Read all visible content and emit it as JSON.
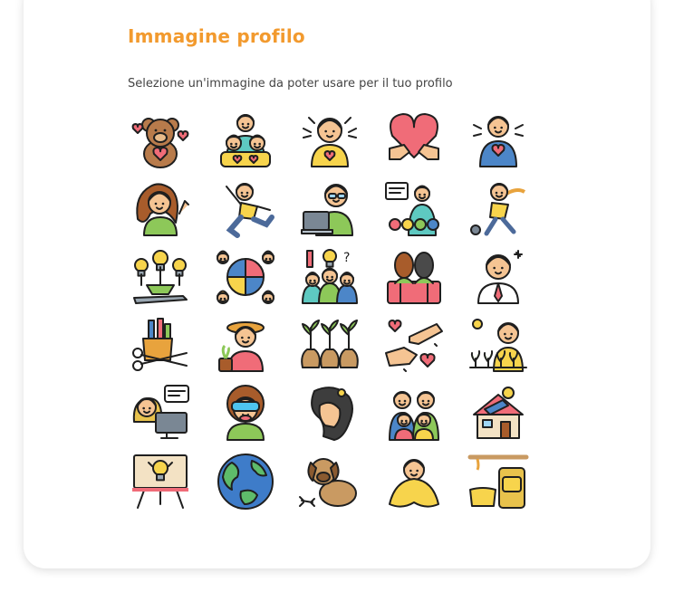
{
  "page": {
    "title": "Immagine profilo",
    "subtitle": "Selezione un'immagine da poter usare per il tuo profilo"
  },
  "colors": {
    "accent": "#F29A2E",
    "outline": "#1f1f1f",
    "skin": "#F5C493",
    "hair": "#6B4A2F",
    "heart": "#F06C78",
    "teal": "#5EC9C1",
    "yellow": "#F7D44C",
    "green": "#8DC859",
    "blue": "#4C86C8"
  },
  "avatars": [
    {
      "icon": "teddy-bear-icon"
    },
    {
      "icon": "family-hug-icon"
    },
    {
      "icon": "happy-boy-icon"
    },
    {
      "icon": "heart-hands-icon"
    },
    {
      "icon": "self-love-icon"
    },
    {
      "icon": "laughing-girl-icon"
    },
    {
      "icon": "jumping-person-icon"
    },
    {
      "icon": "worker-laptop-icon"
    },
    {
      "icon": "teacher-presentation-icon"
    },
    {
      "icon": "bowling-girl-icon"
    },
    {
      "icon": "creative-ideas-icon"
    },
    {
      "icon": "puzzle-team-icon"
    },
    {
      "icon": "brainstorm-team-icon"
    },
    {
      "icon": "couple-icon"
    },
    {
      "icon": "businessman-icon"
    },
    {
      "icon": "stationery-icon"
    },
    {
      "icon": "gardener-girl-icon"
    },
    {
      "icon": "money-plants-icon"
    },
    {
      "icon": "caring-hands-icon"
    },
    {
      "icon": "farmer-icon"
    },
    {
      "icon": "girl-computer-icon"
    },
    {
      "icon": "vr-person-icon"
    },
    {
      "icon": "woman-profile-icon"
    },
    {
      "icon": "family-group-icon"
    },
    {
      "icon": "solar-house-icon"
    },
    {
      "icon": "idea-board-icon"
    },
    {
      "icon": "earth-globe-icon"
    },
    {
      "icon": "dog-icon"
    },
    {
      "icon": "person-blanket-icon"
    },
    {
      "icon": "honey-jar-icon"
    }
  ]
}
